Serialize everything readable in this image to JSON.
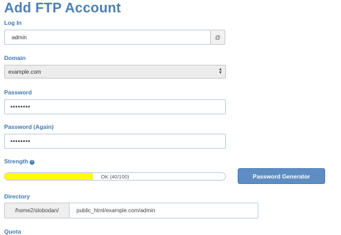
{
  "page": {
    "title": "Add FTP Account"
  },
  "login": {
    "label": "Log In",
    "value": "admin",
    "addon": "@"
  },
  "domain": {
    "label": "Domain",
    "selected": "example.com"
  },
  "password": {
    "label": "Password",
    "value": "••••••••"
  },
  "password_again": {
    "label": "Password (Again)",
    "value": "••••••••"
  },
  "strength": {
    "label": "Strength",
    "info_icon": "i",
    "text": "OK (40/100)",
    "score": 40,
    "max": 100,
    "color": "#ffff00"
  },
  "generator": {
    "label": "Password Generator"
  },
  "directory": {
    "label": "Directory",
    "prefix": "/home2/slobodan/",
    "value": "public_html/example.com/admin"
  },
  "quota": {
    "label": "Quota"
  },
  "colors": {
    "accent": "#3d76b0",
    "button": "#5d8dc3"
  }
}
